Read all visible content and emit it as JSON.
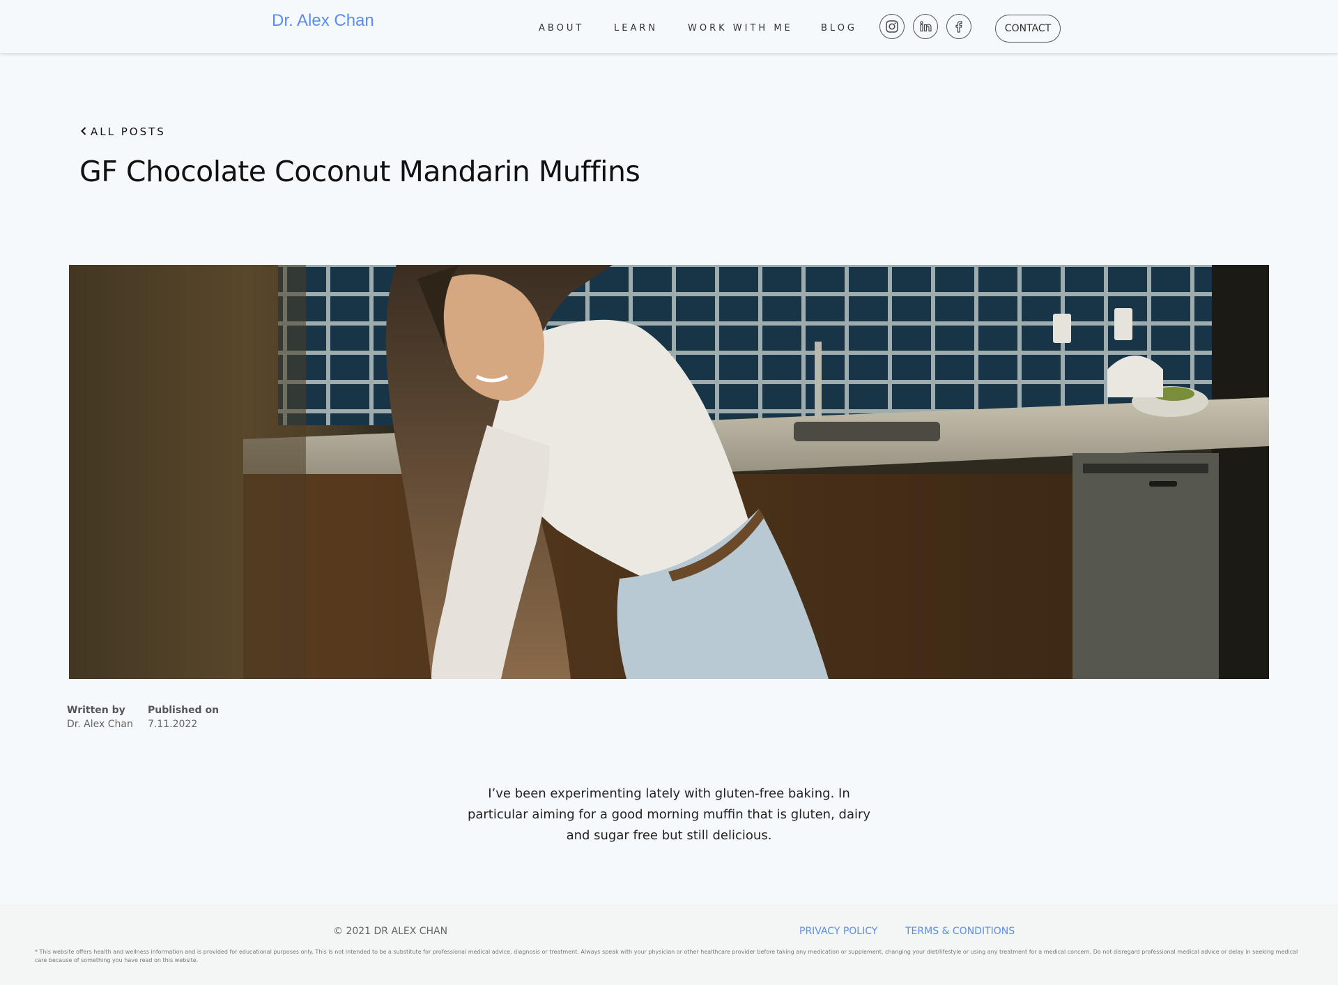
{
  "header": {
    "brand": "Dr. Alex Chan",
    "nav": [
      "ABOUT",
      "LEARN",
      "WORK WITH ME",
      "BLOG"
    ],
    "social_icons": [
      "instagram-icon",
      "linkedin-icon",
      "facebook-icon"
    ],
    "contact_label": "CONTACT",
    "accent_color": "#5b8def"
  },
  "post": {
    "back_label": "ALL POSTS",
    "title": "GF Chocolate Coconut Mandarin Muffins",
    "hero_alt": "Woman smiling while baking in a kitchen",
    "written_by_label": "Written by",
    "author": "Dr. Alex Chan",
    "published_label": "Published on",
    "date": "7.11.2022",
    "intro": "I’ve been experimenting lately with gluten-free baking. In particular aiming for a good morning muffin that is gluten, dairy and sugar free but still delicious."
  },
  "footer": {
    "copyright": "© 2021 DR ALEX CHAN",
    "privacy": "PRIVACY POLICY",
    "terms": "TERMS & CONDITIONS",
    "disclaimer": "* This website offers health and wellness information and is provided for educational purposes only. This is not intended to be a substitute for professional medical advice, diagnosis or treatment. Always speak with your physician or other healthcare provider before taking any medication or supplement, changing your diet/lifestyle or using any treatment for a medical concern. Do not disregard professional medical advice or delay in seeking medical care because of something you have read on this website."
  }
}
